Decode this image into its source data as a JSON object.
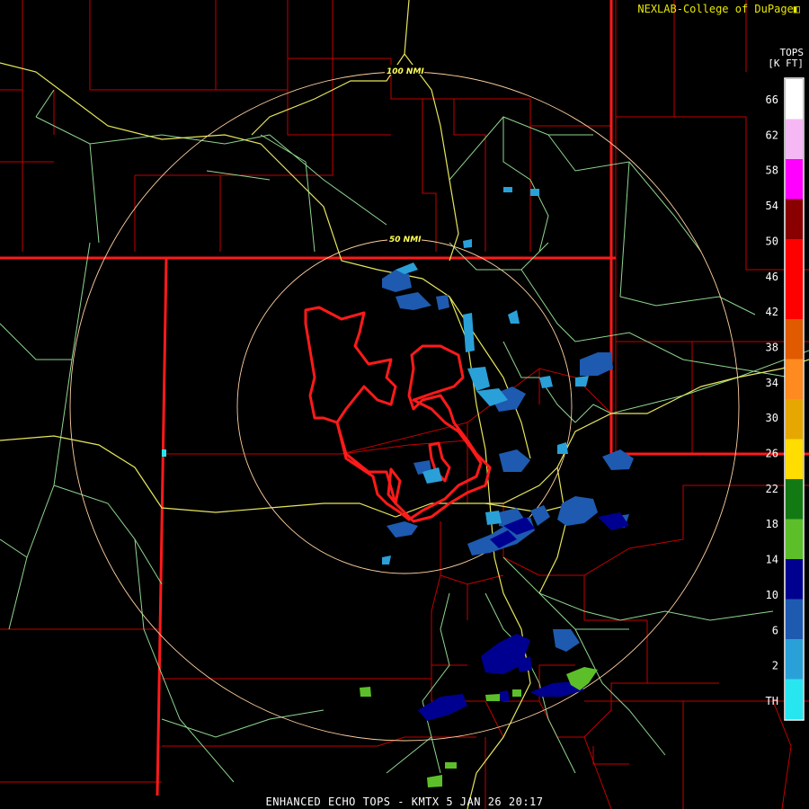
{
  "header": {
    "credit": "NEXLAB-College of DuPage"
  },
  "legend": {
    "title_line1": "TOPS",
    "title_line2": "[K FT]",
    "ticks": [
      "66",
      "62",
      "58",
      "54",
      "50",
      "46",
      "42",
      "38",
      "34",
      "30",
      "26",
      "22",
      "18",
      "14",
      "10",
      "6",
      "2",
      "TH"
    ],
    "colors": [
      "#ffffff",
      "#f5b8f5",
      "#ff00ff",
      "#8a0000",
      "#ff0000",
      "#ff0000",
      "#e05a00",
      "#ff8a20",
      "#e6a800",
      "#ffdd00",
      "#137a13",
      "#5cbf2a",
      "#000090",
      "#1e5ab0",
      "#2aa0d8",
      "#28e6f0"
    ]
  },
  "rings": [
    {
      "label": "100 NMI"
    },
    {
      "label": "50 NMI"
    }
  ],
  "footer": {
    "product": "ENHANCED ECHO TOPS",
    "station": "KMTX",
    "timestamp": "5 JAN 26 20:17"
  },
  "map_colors": {
    "state_border": "#ff1a1a",
    "county_border": "#c00000",
    "highway": "#e6e65a",
    "road": "#8fd68f",
    "range_ring": "#ffd0a0"
  }
}
